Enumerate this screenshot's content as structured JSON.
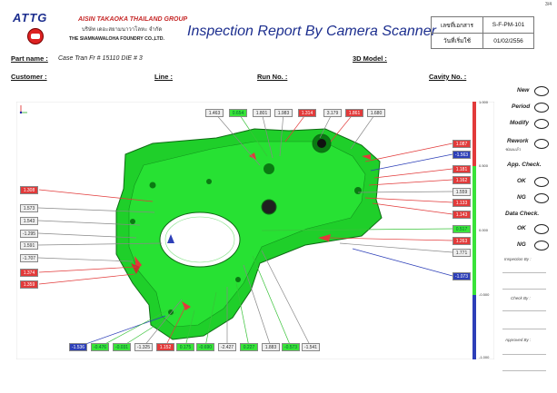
{
  "page_number": "3/4",
  "header": {
    "logo_text": "ATTG",
    "company_line1": "AISIN TAKAOKA THAILAND GROUP",
    "company_thai": "บริษัท เดอะสยามนาวาโลหะ จำกัด",
    "company_en": "THE SIAMNAWALOHA FOUNDRY CO.,LTD.",
    "title": "Inspection Report By Camera Scanner",
    "doc_label": "เลขที่เอกสาร",
    "doc_no": "S-F-PM-101",
    "date_label": "วันที่เริ่มใช้",
    "date_value": "01/02/2556"
  },
  "info": {
    "part_name_label": "Part name :",
    "part_name_value": "Case Tran Fr # 15110 DIE # 3",
    "model_label": "3D Model :",
    "customer_label": "Customer :",
    "line_label": "Line :",
    "run_label": "Run No. :",
    "cavity_label": "Cavity No. :"
  },
  "colors": {
    "title_blue": "#1d2f8f",
    "part_green": "#1fcf2a",
    "in_tol_green": "#39e339",
    "over_red": "#e23a3a",
    "under_blue": "#2d3fb8"
  },
  "scale": {
    "top": "1.000",
    "upper_mid": "0.500",
    "mid": "0.000",
    "lower_mid": "-0.500",
    "bottom": "-1.000"
  },
  "labels_top": [
    {
      "text": "1.463",
      "status": "white"
    },
    {
      "text": "0.654",
      "status": "green"
    },
    {
      "text": "1.801",
      "status": "white"
    },
    {
      "text": "1.983",
      "status": "white"
    },
    {
      "text": "1.314",
      "status": "red"
    },
    {
      "text": "3.179",
      "status": "white"
    },
    {
      "text": "1.861",
      "status": "red"
    },
    {
      "text": "1.680",
      "status": "white"
    }
  ],
  "labels_left": [
    {
      "text": "1.308",
      "status": "red"
    },
    {
      "text": "1.573",
      "status": "white"
    },
    {
      "text": "1.543",
      "status": "white"
    },
    {
      "text": "-1.295",
      "status": "white"
    },
    {
      "text": "1.591",
      "status": "white"
    },
    {
      "text": "-1.707",
      "status": "white"
    },
    {
      "text": "1.374",
      "status": "red"
    },
    {
      "text": "1.359",
      "status": "red"
    }
  ],
  "labels_right": [
    {
      "text": "1.087",
      "status": "red"
    },
    {
      "text": "-1.563",
      "status": "blue"
    },
    {
      "text": "1.181",
      "status": "red"
    },
    {
      "text": "1.162",
      "status": "red"
    },
    {
      "text": "1.559",
      "status": "white"
    },
    {
      "text": "1.133",
      "status": "red"
    },
    {
      "text": "1.143",
      "status": "red"
    },
    {
      "text": "0.517",
      "status": "green"
    },
    {
      "text": "1.263",
      "status": "red"
    },
    {
      "text": "1.771",
      "status": "white"
    },
    {
      "text": "-1.073",
      "status": "blue"
    }
  ],
  "labels_bottom": [
    {
      "text": "-1.536",
      "status": "blue"
    },
    {
      "text": "-0.476",
      "status": "green"
    },
    {
      "text": "-0.031",
      "status": "green"
    },
    {
      "text": "-1.325",
      "status": "white"
    },
    {
      "text": "1.152",
      "status": "red"
    },
    {
      "text": "0.175",
      "status": "green"
    },
    {
      "text": "-0.690",
      "status": "green"
    },
    {
      "text": "-2.427",
      "status": "white"
    },
    {
      "text": "0.227",
      "status": "green"
    },
    {
      "text": "1.883",
      "status": "white"
    },
    {
      "text": "-0.573",
      "status": "green"
    },
    {
      "text": "-1.541",
      "status": "white"
    }
  ],
  "sidebar": {
    "new": "New",
    "period": "Period",
    "modify": "Modify",
    "rework": "Rework",
    "rework_sub": "ซ่อมแล้ว",
    "app_check": "App. Check.",
    "app_ok": "OK",
    "app_ng": "NG",
    "data_check": "Data Check.",
    "data_ok": "OK",
    "data_ng": "NG",
    "inspection_by": "Inspection By :",
    "check_by": "Check By :",
    "approved_by": "Approved By :"
  }
}
